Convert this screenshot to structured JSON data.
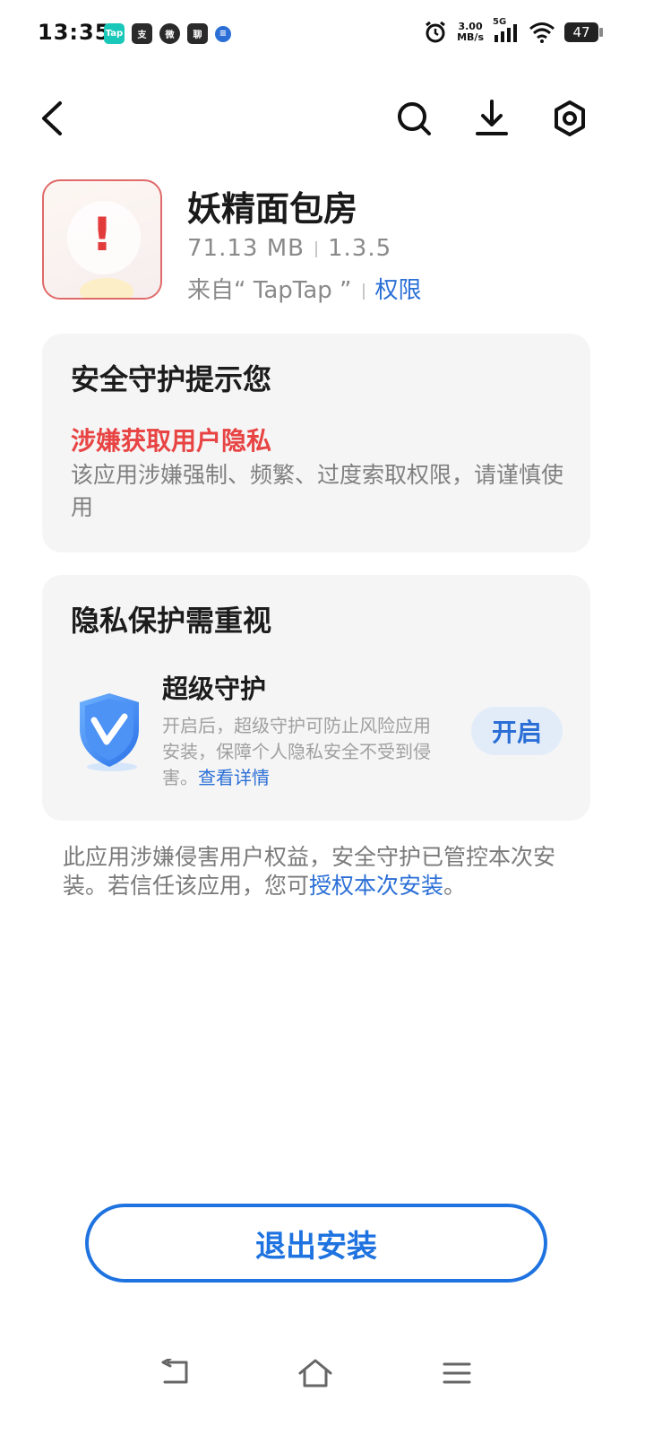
{
  "status_bar": {
    "time": "13:35",
    "app_icons": [
      {
        "name": "taptap-icon",
        "label": "Tap",
        "color": "#19c8b9"
      },
      {
        "name": "zhifubao-icon",
        "label": "支",
        "color": "#2a2a2a"
      },
      {
        "name": "wechat-icon",
        "label": "微",
        "color": "#2a2a2a"
      },
      {
        "name": "chat-bubble-icon",
        "label": "聊",
        "color": "#2a2a2a"
      },
      {
        "name": "notification-dot-icon",
        "label": "≡",
        "color": "#2b6fd6"
      }
    ],
    "net_speed_value": "3.00",
    "net_speed_unit": "MB/s",
    "network": "5G",
    "battery": "47"
  },
  "app": {
    "name": "妖精面包房",
    "size": "71.13 MB",
    "version": "1.3.5",
    "source": "来自“ TapTap ”",
    "permissions_link": "权限",
    "warning_symbol": "!"
  },
  "security_card": {
    "title": "安全守护提示您",
    "risk_title": "涉嫌获取用户隐私",
    "risk_desc": "该应用涉嫌强制、频繁、过度索取权限，请谨慎使用"
  },
  "privacy_card": {
    "title": "隐私保护需重视",
    "protection_title": "超级守护",
    "protection_desc": "开启后，超级守护可防止风险应用安装，保障个人隐私安全不受到侵害。",
    "details_link": "查看详情",
    "enable_button": "开启"
  },
  "notice": {
    "text": "此应用涉嫌侵害用户权益，安全守护已管控本次安装。若信任该应用，您可",
    "authorize_link": "授权本次安装",
    "end": "。"
  },
  "exit_button": "退出安装",
  "colors": {
    "accent_blue": "#2b6fd6",
    "risk_red": "#e84444",
    "card_bg": "#f5f5f5"
  }
}
